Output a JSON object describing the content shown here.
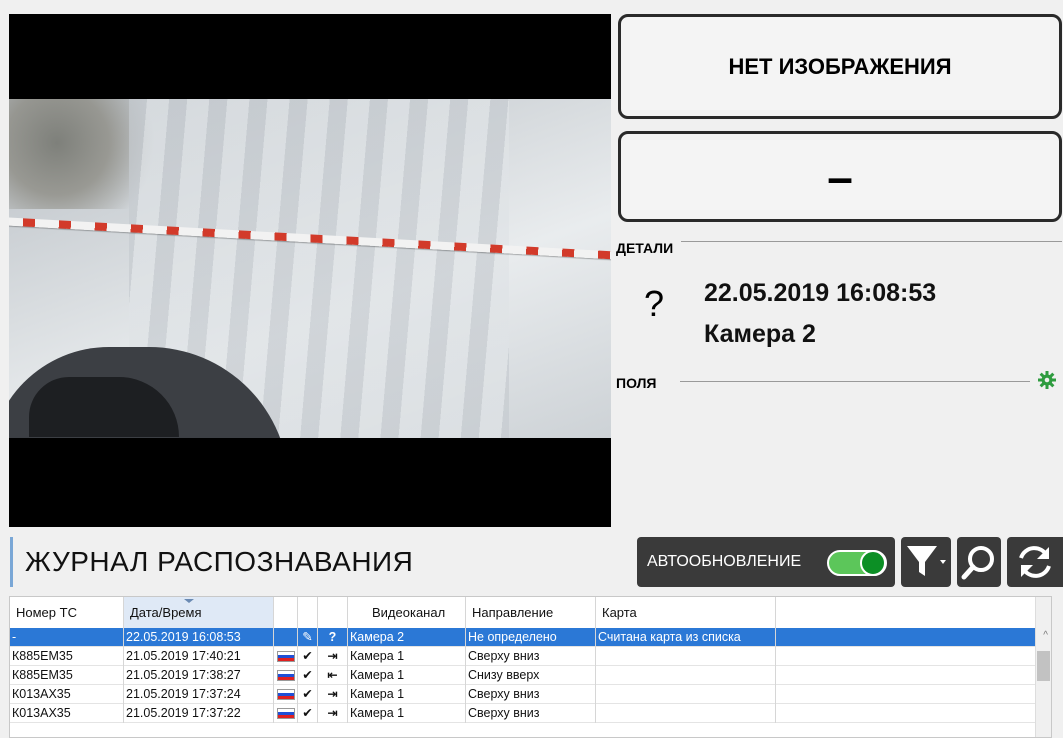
{
  "right_panel": {
    "no_image_label": "НЕТ ИЗОБРАЖЕНИЯ",
    "plate_label": "–",
    "details_label": "ДЕТАЛИ",
    "details_icon": "?",
    "details_datetime": "22.05.2019 16:08:53",
    "details_camera": "Камера 2",
    "fields_label": "ПОЛЯ",
    "fields_gear_icon": "gear-icon"
  },
  "journal": {
    "title": "ЖУРНАЛ РАСПОЗНАВАНИЯ",
    "autoupdate_label": "АВТООБНОВЛЕНИЕ",
    "autoupdate_on": true,
    "tools": [
      "filter-icon",
      "search-icon",
      "refresh-icon"
    ]
  },
  "table": {
    "columns": [
      "Номер ТС",
      "Дата/Время",
      "",
      "",
      "",
      "Видеоканал",
      "Направление",
      "Карта",
      ""
    ],
    "rows": [
      {
        "plate": "-",
        "datetime": "22.05.2019 16:08:53",
        "flag": false,
        "status": "✎",
        "direction_icon": "?",
        "channel": "Камера 2",
        "direction": "Не определено",
        "card": "Считана карта из списка"
      },
      {
        "plate": "К885ЕМ35",
        "datetime": "21.05.2019 17:40:21",
        "flag": true,
        "status": "✔",
        "direction_icon": "⇥",
        "channel": "Камера 1",
        "direction": "Сверху вниз",
        "card": ""
      },
      {
        "plate": "К885ЕМ35",
        "datetime": "21.05.2019 17:38:27",
        "flag": true,
        "status": "✔",
        "direction_icon": "⇤",
        "channel": "Камера 1",
        "direction": "Снизу вверх",
        "card": ""
      },
      {
        "plate": "К013АХ35",
        "datetime": "21.05.2019 17:37:24",
        "flag": true,
        "status": "✔",
        "direction_icon": "⇥",
        "channel": "Камера 1",
        "direction": "Сверху вниз",
        "card": ""
      },
      {
        "plate": "К013АХ35",
        "datetime": "21.05.2019 17:37:22",
        "flag": true,
        "status": "✔",
        "direction_icon": "⇥",
        "channel": "Камера 1",
        "direction": "Сверху вниз",
        "card": ""
      }
    ]
  },
  "colors": {
    "selected_row": "#2b78d6",
    "toggle_on": "#5cc65a",
    "gear": "#2e9c3f",
    "button_dark": "#3a3a3a"
  }
}
